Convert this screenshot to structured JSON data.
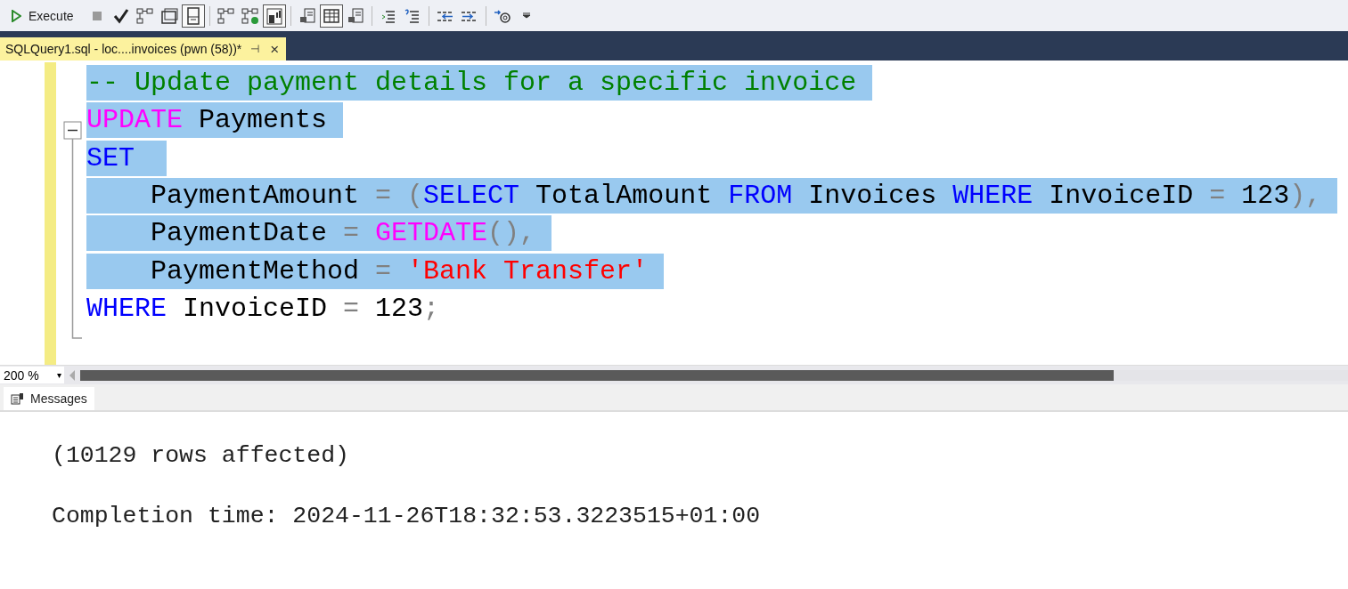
{
  "toolbar": {
    "execute_label": "Execute",
    "buttons": [
      {
        "kind": "stop",
        "selected": false
      },
      {
        "kind": "check",
        "selected": false
      },
      {
        "kind": "diagram",
        "selected": false
      },
      {
        "kind": "windows",
        "selected": false
      },
      {
        "kind": "page",
        "selected": true
      },
      {
        "kind": "diagram",
        "selected": false
      },
      {
        "kind": "diagram-check",
        "selected": false
      },
      {
        "kind": "chart",
        "selected": true
      },
      {
        "kind": "text-page",
        "selected": false
      },
      {
        "kind": "grid",
        "selected": true
      },
      {
        "kind": "file",
        "selected": false
      },
      {
        "kind": "lines",
        "selected": false
      },
      {
        "kind": "lines-mark",
        "selected": false
      },
      {
        "kind": "outdent",
        "selected": false
      },
      {
        "kind": "indent",
        "selected": false
      },
      {
        "kind": "at-arrow",
        "selected": false
      },
      {
        "kind": "overflow",
        "selected": false
      }
    ]
  },
  "tab": {
    "title": "SQLQuery1.sql - loc....invoices (pwn (58))*",
    "pin": "⊣",
    "close": "×"
  },
  "editor": {
    "lines": [
      {
        "selected": true,
        "tokens": [
          {
            "kind": "comment",
            "text": "-- Update payment details for a specific invoice"
          }
        ]
      },
      {
        "selected": true,
        "tokens": [
          {
            "kind": "function",
            "text": "UPDATE"
          },
          {
            "kind": "plain",
            "text": " Payments"
          }
        ]
      },
      {
        "selected": true,
        "tokens": [
          {
            "kind": "keyword",
            "text": "SET"
          }
        ]
      },
      {
        "selected": true,
        "tokens": [
          {
            "kind": "plain",
            "text": "    PaymentAmount "
          },
          {
            "kind": "operator",
            "text": "= ("
          },
          {
            "kind": "keyword",
            "text": "SELECT"
          },
          {
            "kind": "plain",
            "text": " TotalAmount "
          },
          {
            "kind": "keyword",
            "text": "FROM"
          },
          {
            "kind": "plain",
            "text": " Invoices "
          },
          {
            "kind": "keyword",
            "text": "WHERE"
          },
          {
            "kind": "plain",
            "text": " InvoiceID "
          },
          {
            "kind": "operator",
            "text": "="
          },
          {
            "kind": "plain",
            "text": " 123"
          },
          {
            "kind": "operator",
            "text": "),"
          }
        ]
      },
      {
        "selected": true,
        "tokens": [
          {
            "kind": "plain",
            "text": "    PaymentDate "
          },
          {
            "kind": "operator",
            "text": "= "
          },
          {
            "kind": "function",
            "text": "GETDATE"
          },
          {
            "kind": "operator",
            "text": "(),"
          }
        ]
      },
      {
        "selected": true,
        "tokens": [
          {
            "kind": "plain",
            "text": "    PaymentMethod "
          },
          {
            "kind": "operator",
            "text": "= "
          },
          {
            "kind": "string",
            "text": "'Bank Transfer'"
          }
        ]
      },
      {
        "selected": false,
        "tokens": [
          {
            "kind": "keyword",
            "text": "WHERE"
          },
          {
            "kind": "plain",
            "text": " InvoiceID "
          },
          {
            "kind": "operator",
            "text": "="
          },
          {
            "kind": "plain",
            "text": " 123"
          },
          {
            "kind": "operator",
            "text": ";"
          }
        ]
      }
    ]
  },
  "zoom": {
    "value": "200 %",
    "caret": "▾"
  },
  "messages": {
    "tab": "Messages",
    "lines": [
      "(10129 rows affected)",
      "Completion time: 2024-11-26T18:32:53.3223515+01:00"
    ]
  }
}
